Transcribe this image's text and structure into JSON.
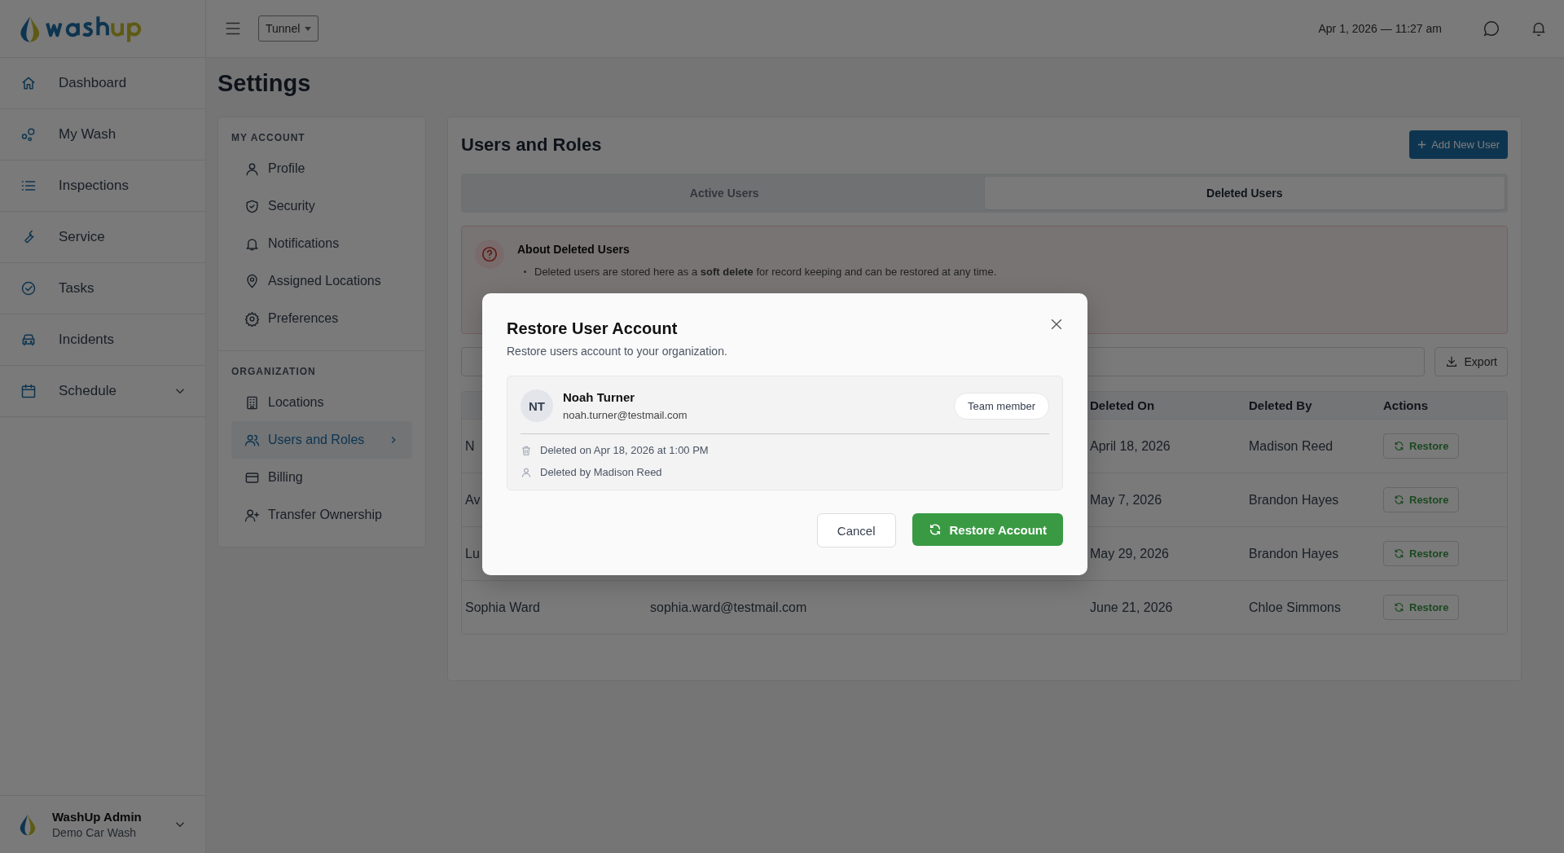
{
  "header": {
    "location_select": "Tunnel",
    "datetime": "Apr 1, 2026 — 11:27 am"
  },
  "sidebar": {
    "items": [
      {
        "label": "Dashboard",
        "kind": "link"
      },
      {
        "label": "My Wash",
        "kind": "link"
      },
      {
        "label": "Inspections",
        "kind": "link"
      },
      {
        "label": "Service",
        "kind": "link"
      },
      {
        "label": "Tasks",
        "kind": "link"
      },
      {
        "label": "Incidents",
        "kind": "link"
      },
      {
        "label": "Schedule",
        "kind": "group"
      }
    ],
    "account": {
      "name": "WashUp Admin",
      "org": "Demo Car Wash"
    }
  },
  "page_title": "Settings",
  "settings_nav": [
    {
      "heading": "MY ACCOUNT",
      "items": [
        {
          "label": "Profile",
          "selected": false
        },
        {
          "label": "Security",
          "selected": false
        },
        {
          "label": "Notifications",
          "selected": false
        },
        {
          "label": "Assigned Locations",
          "selected": false
        },
        {
          "label": "Preferences",
          "selected": false
        }
      ]
    },
    {
      "heading": "ORGANIZATION",
      "items": [
        {
          "label": "Locations",
          "selected": false
        },
        {
          "label": "Users and Roles",
          "selected": true
        },
        {
          "label": "Billing",
          "selected": false
        },
        {
          "label": "Transfer Ownership",
          "selected": false
        }
      ]
    }
  ],
  "panel": {
    "title": "Users and Roles",
    "add_button": "Add New User",
    "tabs": [
      {
        "label": "Active Users",
        "selected": false
      },
      {
        "label": "Deleted Users",
        "selected": true
      }
    ],
    "notice": {
      "title": "About Deleted Users",
      "bullets": [
        "Deleted users are stored here as a **soft delete** for record keeping and can be restored at any time."
      ]
    },
    "export_button": "Export",
    "table": {
      "columns": [
        "",
        "",
        "Deleted On",
        "Deleted By",
        "Actions"
      ],
      "rows": [
        {
          "name": "N",
          "email": "",
          "deleted_on": "April 18, 2026",
          "deleted_by": "Madison Reed",
          "action": "Restore"
        },
        {
          "name": "Av",
          "email": "",
          "deleted_on": "May 7, 2026",
          "deleted_by": "Brandon Hayes",
          "action": "Restore"
        },
        {
          "name": "Lu",
          "email": "",
          "deleted_on": "May 29, 2026",
          "deleted_by": "Brandon Hayes",
          "action": "Restore"
        },
        {
          "name": "Sophia Ward",
          "email": "sophia.ward@testmail.com",
          "deleted_on": "June 21, 2026",
          "deleted_by": "Chloe Simmons",
          "action": "Restore"
        }
      ]
    }
  },
  "modal": {
    "title": "Restore User Account",
    "subtitle": "Restore users account to your organization.",
    "user": {
      "initials": "NT",
      "name": "Noah Turner",
      "email": "noah.turner@testmail.com",
      "role": "Team member"
    },
    "details": [
      "Deleted on Apr 18, 2026 at 1:00 PM",
      "Deleted by Madison Reed"
    ],
    "cancel": "Cancel",
    "confirm": "Restore Account"
  }
}
